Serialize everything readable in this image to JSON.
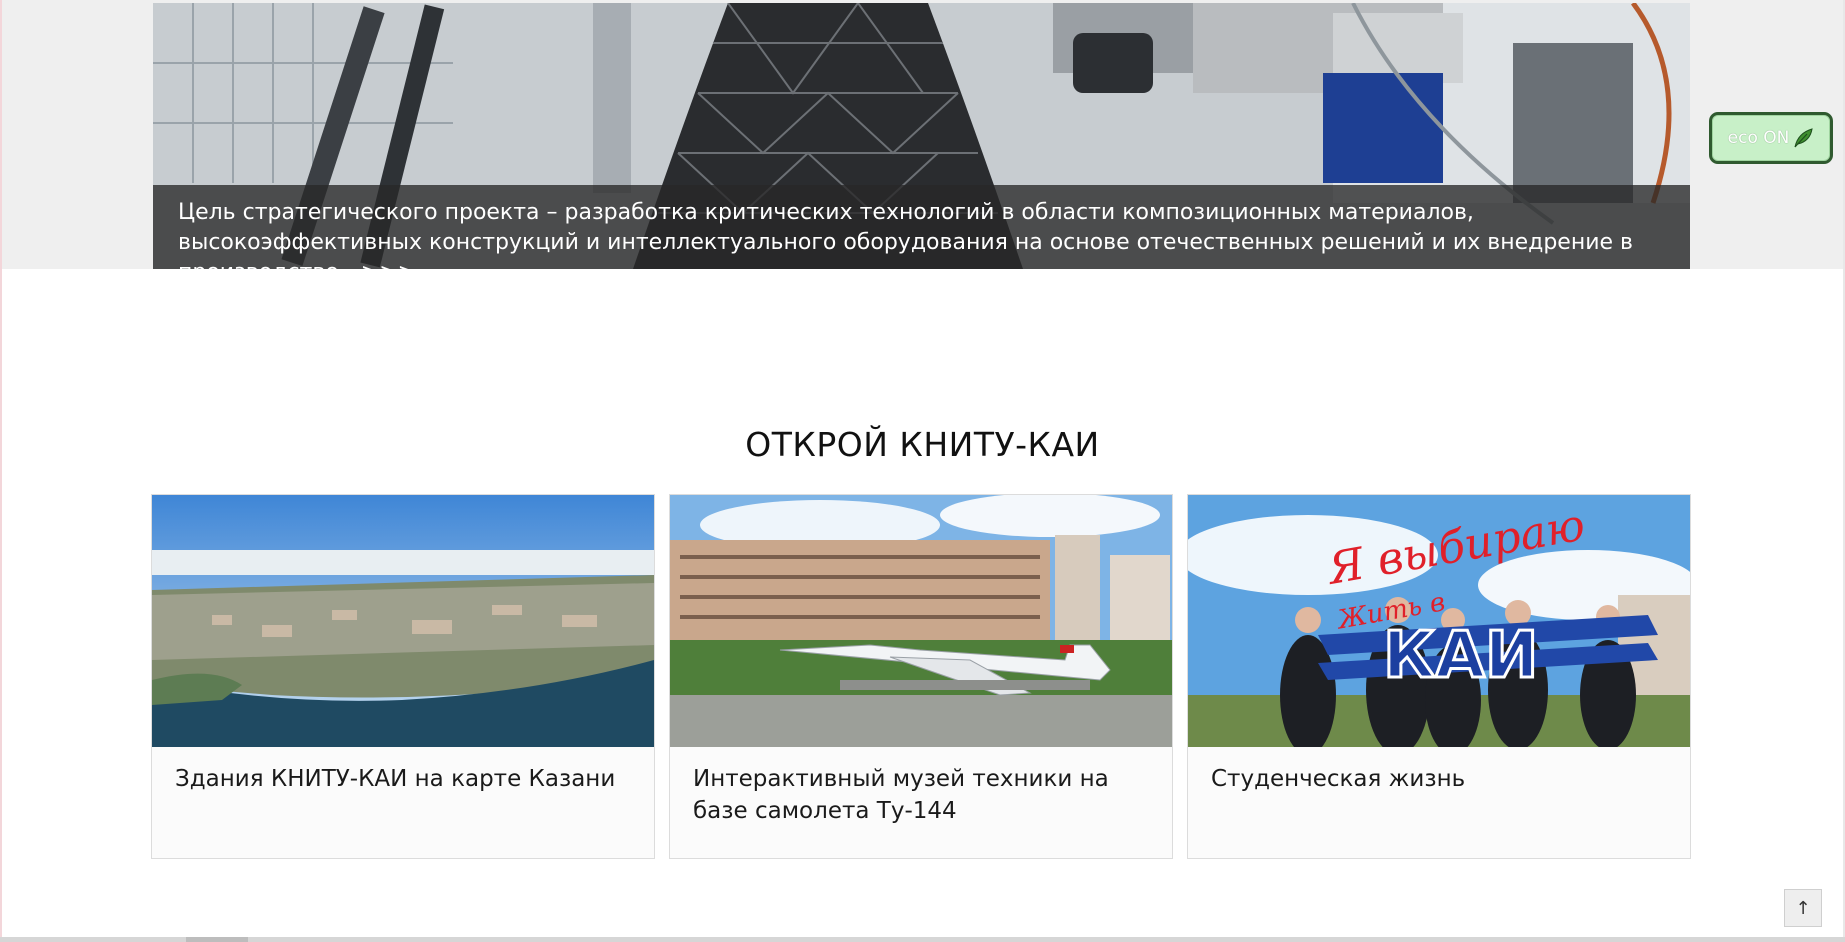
{
  "hero": {
    "caption": "Цель стратегического проекта – разработка критических технологий в области композиционных материалов, высокоэффективных конструкций и интеллектуального оборудования на основе отечественных решений и их внедрение в производство…>>>"
  },
  "eco_button": {
    "label": "eco ON",
    "icon": "leaf-icon",
    "color": "#c8f0c8",
    "border": "#2f5a2f"
  },
  "section": {
    "title": "ОТКРОЙ КНИТУ-КАИ",
    "cards": [
      {
        "title": "Здания КНИТУ-КАИ на карте Казани",
        "image": "city-aerial-photo"
      },
      {
        "title": "Интерактивный музей техники на базе самолета Ту-144",
        "image": "tu144-plane-photo"
      },
      {
        "title": "Студенческая жизнь",
        "image": "student-life-photo",
        "image_text_1": "Я выбираю",
        "image_text_2": "Жить в",
        "logo_text": "КАИ"
      }
    ]
  },
  "scroll_top": {
    "label": "↑"
  }
}
